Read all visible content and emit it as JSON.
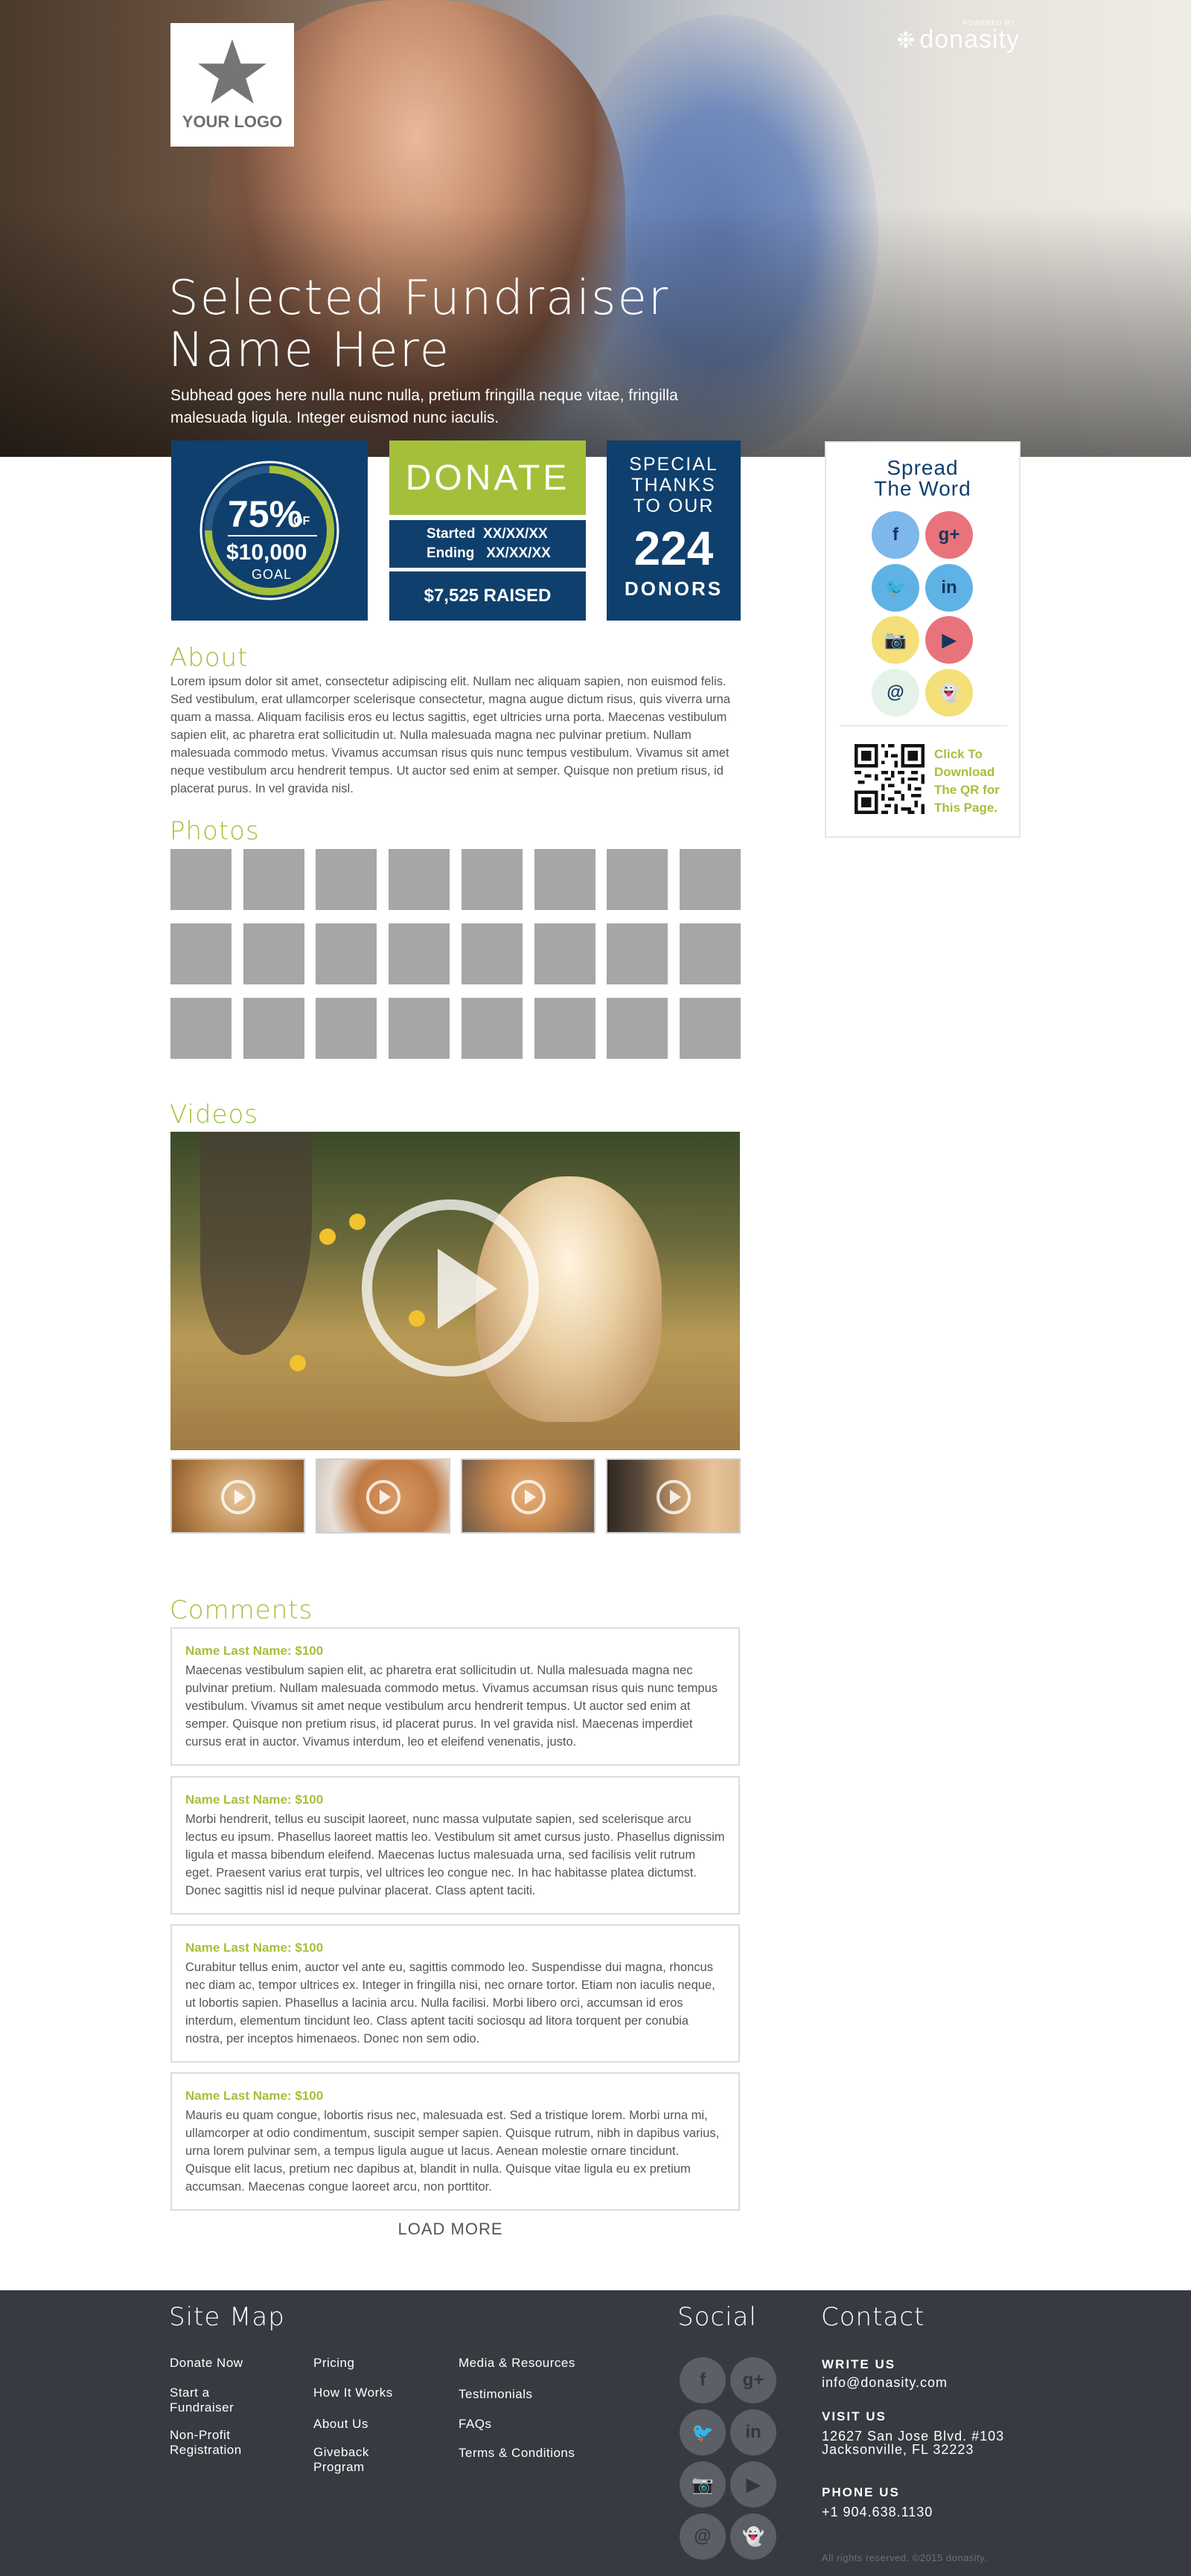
{
  "brand": {
    "logo_text": "YOUR LOGO",
    "powered_by": "POWERED BY",
    "platform": "donasity"
  },
  "hero": {
    "title_line1": "Selected Fundraiser",
    "title_line2": "Name Here",
    "subhead": "Subhead goes here nulla nunc nulla, pretium fringilla neque vitae, fringilla malesuada ligula. Integer euismod nunc iaculis."
  },
  "goal": {
    "percent": "75%",
    "of": "OF",
    "amount": "$10,000",
    "label": "GOAL",
    "progress_fraction": 0.75
  },
  "donate": {
    "label": "DONATE",
    "started": "Started  XX/XX/XX",
    "ending": "Ending   XX/XX/XX",
    "raised": "$7,525 RAISED"
  },
  "donors": {
    "thanks_line1": "SPECIAL",
    "thanks_line2": "THANKS",
    "thanks_line3": "TO OUR",
    "count": "224",
    "label": "DONORS"
  },
  "spread": {
    "title_line1": "Spread",
    "title_line2": "The Word",
    "icons": [
      {
        "name": "facebook-icon",
        "glyph": "f"
      },
      {
        "name": "google-plus-icon",
        "glyph": "g+"
      },
      {
        "name": "twitter-icon",
        "glyph": "🐦"
      },
      {
        "name": "linkedin-icon",
        "glyph": "in"
      },
      {
        "name": "instagram-icon",
        "glyph": "📷"
      },
      {
        "name": "youtube-icon",
        "glyph": "▶"
      },
      {
        "name": "email-icon",
        "glyph": "@"
      },
      {
        "name": "snapchat-icon",
        "glyph": "👻"
      }
    ],
    "qr_link_line1": "Click To",
    "qr_link_line2": "Download",
    "qr_link_line3": "The QR for",
    "qr_link_line4": "This Page."
  },
  "about": {
    "title": "About",
    "text": "Lorem ipsum dolor sit amet, consectetur adipiscing elit. Nullam nec aliquam sapien, non euismod felis. Sed vestibulum, erat ullamcorper scelerisque consectetur, magna augue dictum risus, quis viverra urna quam a massa. Aliquam facilisis eros eu lectus sagittis, eget ultricies urna porta. Maecenas vestibulum sapien elit, ac pharetra erat sollicitudin ut. Nulla malesuada magna nec pulvinar pretium. Nullam malesuada commodo metus. Vivamus accumsan risus quis nunc tempus vestibulum. Vivamus sit amet neque vestibulum arcu hendrerit tempus. Ut auctor sed enim at semper. Quisque non pretium risus, id placerat purus. In vel gravida nisl."
  },
  "photos": {
    "title": "Photos",
    "count": 24
  },
  "videos": {
    "title": "Videos",
    "thumbnail_count": 4
  },
  "comments": {
    "title": "Comments",
    "items": [
      {
        "name": "Name Last Name: $100",
        "text": "Maecenas vestibulum sapien elit, ac pharetra erat sollicitudin ut. Nulla malesuada magna nec pulvinar pretium. Nullam malesuada commodo metus. Vivamus accumsan risus quis nunc tempus vestibulum. Vivamus sit amet neque vestibulum arcu hendrerit tempus. Ut auctor sed enim at semper. Quisque non pretium risus, id placerat purus. In vel gravida nisl. Maecenas imperdiet cursus erat in auctor. Vivamus interdum, leo et eleifend venenatis, justo."
      },
      {
        "name": "Name Last Name: $100",
        "text": "Morbi hendrerit, tellus eu suscipit laoreet, nunc massa vulputate sapien, sed scelerisque arcu lectus eu ipsum. Phasellus laoreet mattis leo. Vestibulum sit amet cursus justo. Phasellus dignissim ligula et massa bibendum eleifend. Maecenas luctus malesuada urna, sed facilisis velit rutrum eget. Praesent varius erat turpis, vel ultrices leo congue nec. In hac habitasse platea dictumst. Donec sagittis nisl id neque pulvinar placerat. Class aptent taciti."
      },
      {
        "name": "Name Last Name: $100",
        "text": "Curabitur tellus enim, auctor vel ante eu, sagittis commodo leo. Suspendisse dui magna, rhoncus nec diam ac, tempor ultrices ex. Integer in fringilla nisi, nec ornare tortor. Etiam non iaculis neque, ut lobortis sapien. Phasellus a lacinia arcu. Nulla facilisi. Morbi libero orci, accumsan id eros interdum, elementum tincidunt leo. Class aptent taciti sociosqu ad litora torquent per conubia nostra, per inceptos himenaeos. Donec non sem odio."
      },
      {
        "name": "Name Last Name: $100",
        "text": "Mauris eu quam congue, lobortis risus nec, malesuada est. Sed a tristique lorem. Morbi urna mi, ullamcorper at odio condimentum, suscipit semper sapien. Quisque rutrum, nibh in dapibus varius, urna lorem pulvinar sem, a tempus ligula augue ut lacus. Aenean molestie ornare tincidunt. Quisque elit lacus, pretium nec dapibus at, blandit in nulla. Quisque vitae ligula eu ex pretium accumsan. Maecenas congue laoreet arcu, non porttitor."
      }
    ],
    "load_more": "LOAD MORE"
  },
  "footer": {
    "sitemap_title": "Site Map",
    "links": [
      {
        "name": "footer-link-donate-now",
        "label": "Donate Now"
      },
      {
        "name": "footer-link-start-fundraiser",
        "label": "Start a\nFundraiser"
      },
      {
        "name": "footer-link-nonprofit-registration",
        "label": "Non-Profit\nRegistration"
      },
      {
        "name": "footer-link-pricing",
        "label": "Pricing"
      },
      {
        "name": "footer-link-how-it-works",
        "label": "How It Works"
      },
      {
        "name": "footer-link-about-us",
        "label": "About Us"
      },
      {
        "name": "footer-link-giveback-program",
        "label": "Giveback\nProgram"
      },
      {
        "name": "footer-link-media-resources",
        "label": "Media & Resources"
      },
      {
        "name": "footer-link-testimonials",
        "label": "Testimonials"
      },
      {
        "name": "footer-link-faqs",
        "label": "FAQs"
      },
      {
        "name": "footer-link-terms",
        "label": "Terms & Conditions"
      }
    ],
    "social_title": "Social",
    "contact_title": "Contact",
    "write_us_label": "WRITE US",
    "email": "info@donasity.com",
    "visit_us_label": "VISIT US",
    "address_line1": "12627 San Jose Blvd. #103",
    "address_line2": "Jacksonville, FL 32223",
    "phone_label": "PHONE US",
    "phone": "+1 904.638.1130",
    "copyright": "All rights reserved. ©2015 donasity."
  },
  "colors": {
    "navy": "#0f3f6d",
    "green": "#a4c03a",
    "footer_bg": "#373a40",
    "photo_placeholder": "#a6a6a6"
  }
}
